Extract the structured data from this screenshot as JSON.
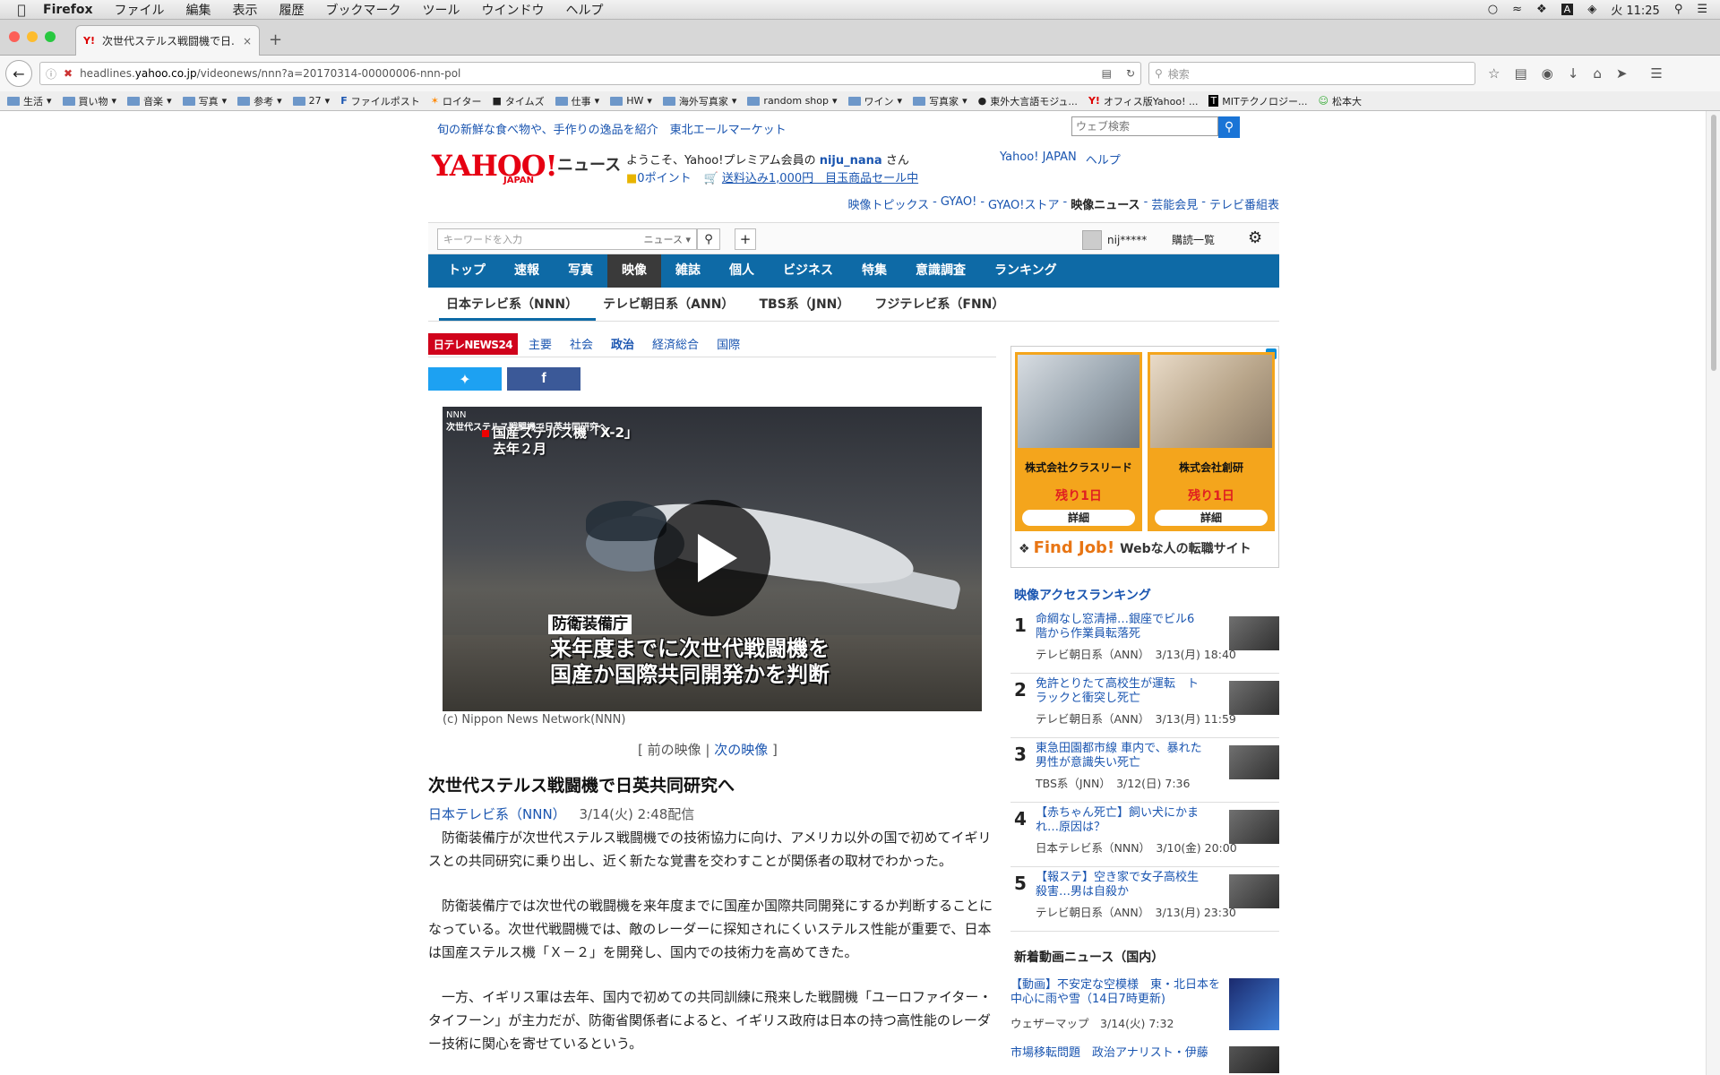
{
  "menubar": {
    "app": "Firefox",
    "items": [
      "ファイル",
      "編集",
      "表示",
      "履歴",
      "ブックマーク",
      "ツール",
      "ウインドウ",
      "ヘルプ"
    ],
    "clock": "火 11:25"
  },
  "tab": {
    "favicon": "Y!",
    "title": "次世代ステルス戦闘機で日..."
  },
  "urlbar": {
    "domain_prefix": "headlines.",
    "domain": "yahoo.co.jp",
    "path": "/videonews/nnn?a=20170314-00000006-nnn-pol",
    "search_placeholder": "検索"
  },
  "bookmarks": [
    "生活",
    "買い物",
    "音楽",
    "写真",
    "参考",
    "27",
    "ファイルポスト",
    "ロイター",
    "タイムズ",
    "仕事",
    "HW",
    "海外写真家",
    "random shop",
    "ワイン",
    "写真家",
    "東外大言語モジュ...",
    "オフィス版Yahoo! ...",
    "MITテクノロジー...",
    "松本大"
  ],
  "header": {
    "promo": "旬の新鮮な食べ物や、手作りの逸品を紹介　東北エールマーケット",
    "web_search_placeholder": "ウェブ検索",
    "logo": "YAHOO!",
    "logo_sub": "JAPAN",
    "logo_news": "ニュース",
    "welcome_prefix": "ようこそ、Yahoo!プレミアム会員の ",
    "welcome_user": "niju_nana",
    "welcome_suffix": " さん",
    "points": "0ポイント",
    "shop": "送料込み1,000円　目玉商品セール中",
    "top_links": [
      "Yahoo! JAPAN",
      "ヘルプ"
    ],
    "sub_links": [
      "映像トピックス",
      "GYAO!",
      "GYAO!ストア",
      "映像ニュース",
      "芸能会見",
      "テレビ番組表"
    ],
    "sub_sep": " - "
  },
  "searchbar": {
    "placeholder": "キーワードを入力",
    "scope": "ニュース",
    "user": "nij*****",
    "subscriptions": "購読一覧"
  },
  "categories": [
    {
      "label": "トップ",
      "active": false
    },
    {
      "label": "速報",
      "active": false
    },
    {
      "label": "写真",
      "active": false
    },
    {
      "label": "映像",
      "active": true
    },
    {
      "label": "雑誌",
      "active": false
    },
    {
      "label": "個人",
      "active": false
    },
    {
      "label": "ビジネス",
      "active": false
    },
    {
      "label": "特集",
      "active": false
    },
    {
      "label": "意識調査",
      "active": false
    },
    {
      "label": "ランキング",
      "active": false
    }
  ],
  "network_tabs": [
    {
      "label": "日本テレビ系（NNN）",
      "active": true
    },
    {
      "label": "テレビ朝日系（ANN）",
      "active": false
    },
    {
      "label": "TBS系（JNN）",
      "active": false
    },
    {
      "label": "フジテレビ系（FNN）",
      "active": false
    }
  ],
  "ntv": {
    "logo": "日テレNEWS24",
    "links": [
      "主要",
      "社会",
      "政治",
      "経済総合",
      "国際"
    ]
  },
  "video": {
    "channel": "NNN",
    "headline": "次世代ステルス戦闘機で日英共同研究へ",
    "subtitle1": "国産ステルス機「X-2」",
    "subtitle2": "去年２月",
    "caption_label": "防衛装備庁",
    "caption_line1": "来年度までに次世代戦闘機を",
    "caption_line2": "国産か国際共同開発かを判断",
    "credit": "(c) Nippon News Network(NNN)",
    "prev": "前の映像",
    "next": "次の映像"
  },
  "article": {
    "title": "次世代ステルス戦闘機で日英共同研究へ",
    "source": "日本テレビ系（NNN）",
    "date": "3/14(火) 2:48配信",
    "paragraphs": [
      "　防衛装備庁が次世代ステルス戦闘機での技術協力に向け、アメリカ以外の国で初めてイギリスとの共同研究に乗り出し、近く新たな覚書を交わすことが関係者の取材でわかった。",
      "　防衛装備庁では次世代の戦闘機を来年度までに国産か国際共同開発にするか判断することになっている。次世代戦闘機では、敵のレーダーに探知されにくいステルス性能が重要で、日本は国産ステルス機「Ｘ－２」を開発し、国内での技術力を高めてきた。",
      "　一方、イギリス軍は去年、国内で初めての共同訓練に飛来した戦闘機「ユーロファイター・タイフーン」が主力だが、防衛省関係者によると、イギリス政府は日本の持つ高性能のレーダー技術に関心を寄せているという。"
    ]
  },
  "ad": {
    "companies": [
      {
        "name": "株式会社クラスリード",
        "remain": "残り1日",
        "button": "詳細"
      },
      {
        "name": "株式会社創研",
        "remain": "残り1日",
        "button": "詳細"
      }
    ],
    "brand": "Find Job!",
    "tagline": "Webな人の転職サイト"
  },
  "ranking": {
    "title": "映像アクセスランキング",
    "items": [
      {
        "rank": "1",
        "text": "命綱なし窓清掃…銀座でビル6階から作業員転落死",
        "source": "テレビ朝日系（ANN）",
        "time": "3/13(月) 18:40"
      },
      {
        "rank": "2",
        "text": "免許とりたて高校生が運転　トラックと衝突し死亡",
        "source": "テレビ朝日系（ANN）",
        "time": "3/13(月) 11:59"
      },
      {
        "rank": "3",
        "text": "東急田園都市線 車内で、暴れた男性が意識失い死亡",
        "source": "TBS系（JNN）",
        "time": "3/12(日) 7:36"
      },
      {
        "rank": "4",
        "text": "【赤ちゃん死亡】飼い犬にかまれ…原因は？",
        "source": "日本テレビ系（NNN）",
        "time": "3/10(金) 20:00"
      },
      {
        "rank": "5",
        "text": "【報ステ】空き家で女子高校生殺害…男は自殺か",
        "source": "テレビ朝日系（ANN）",
        "time": "3/13(月) 23:30"
      }
    ]
  },
  "latest": {
    "title": "新着動画ニュース（国内）",
    "items": [
      {
        "text": "【動画】不安定な空模様　東・北日本を中心に雨や雪（14日7時更新)",
        "source": "ウェザーマップ",
        "time": "3/14(火) 7:32"
      },
      {
        "text": "市場移転問題　政治アナリスト・伊藤",
        "source": "",
        "time": ""
      }
    ]
  }
}
